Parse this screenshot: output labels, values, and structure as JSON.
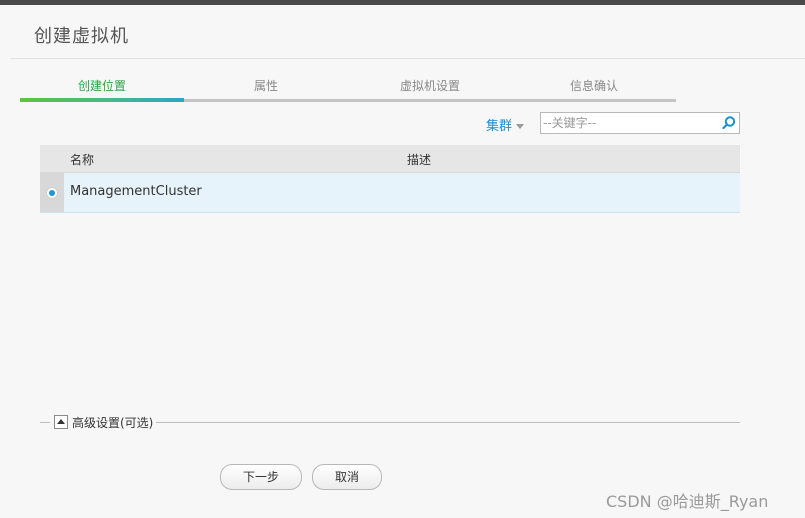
{
  "dialog": {
    "title": "创建虚拟机"
  },
  "steps": [
    {
      "label": "创建位置",
      "active": true
    },
    {
      "label": "属性",
      "active": false
    },
    {
      "label": "虚拟机设置",
      "active": false
    },
    {
      "label": "信息确认",
      "active": false
    }
  ],
  "filter": {
    "label": "集群"
  },
  "search": {
    "placeholder": "--关键字--",
    "value": ""
  },
  "table": {
    "columns": [
      "名称",
      "描述"
    ],
    "rows": [
      {
        "name": "ManagementCluster",
        "description": "",
        "selected": true
      }
    ]
  },
  "advanced": {
    "label": "高级设置(可选)"
  },
  "buttons": {
    "next": "下一步",
    "cancel": "取消"
  },
  "watermark": "CSDN @哈迪斯_Ryan",
  "colors": {
    "accent": "#1a8fd2",
    "active_step": "#2aa54b",
    "selected_row": "#e6f3fb"
  },
  "icons": {
    "search": "search-icon",
    "filter_caret": "chevron-down-icon",
    "advanced_toggle": "caret-up-icon",
    "radio": "radio-selected-icon"
  }
}
